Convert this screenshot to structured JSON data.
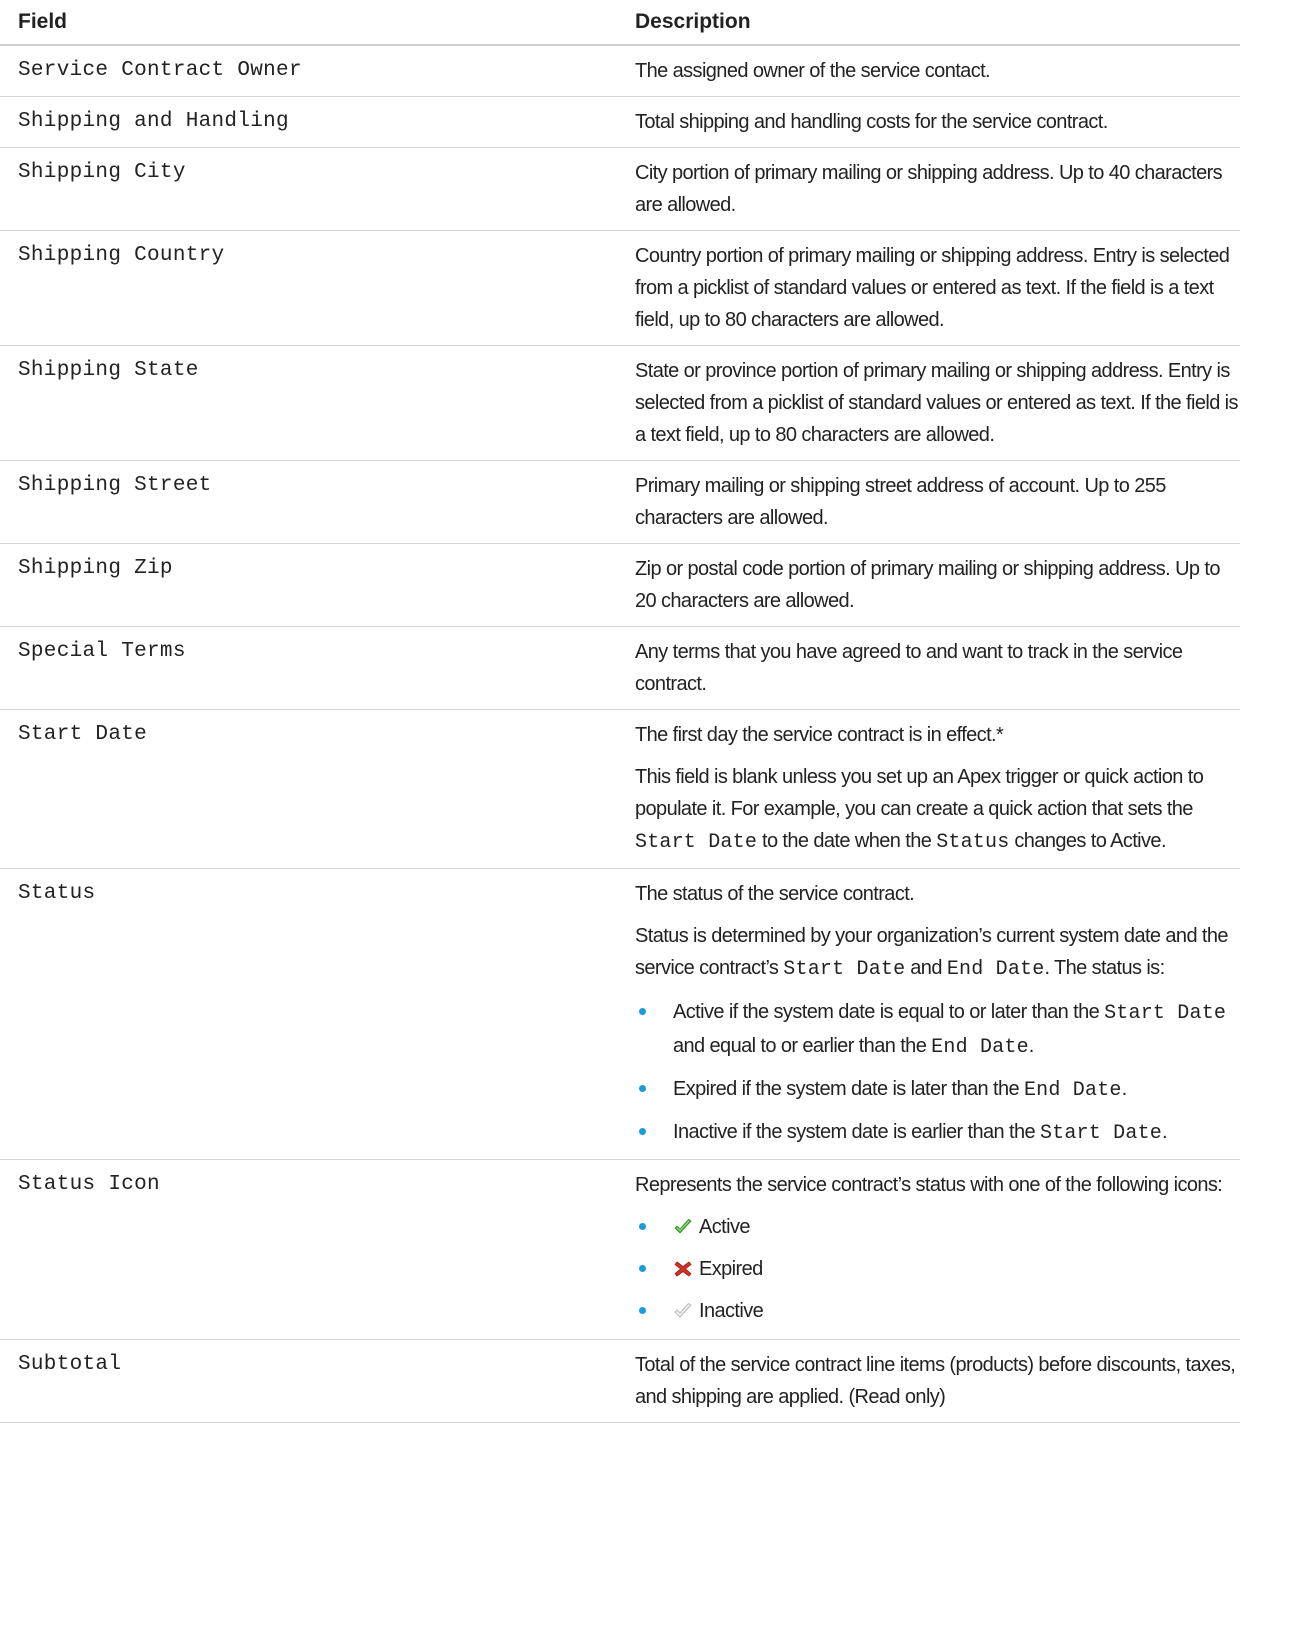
{
  "table": {
    "header": {
      "field": "Field",
      "description": "Description"
    },
    "rows": {
      "service_contract_owner": {
        "field": "Service Contract Owner",
        "description": "The assigned owner of the service contact."
      },
      "shipping_and_handling": {
        "field": "Shipping and Handling",
        "description": "Total shipping and handling costs for the service contract."
      },
      "shipping_city": {
        "field": "Shipping City",
        "description": "City portion of primary mailing or shipping address. Up to 40 characters are allowed."
      },
      "shipping_country": {
        "field": "Shipping Country",
        "description": "Country portion of primary mailing or shipping address. Entry is selected from a picklist of standard values or entered as text. If the field is a text field, up to 80 characters are allowed."
      },
      "shipping_state": {
        "field": "Shipping State",
        "description": "State or province portion of primary mailing or shipping address. Entry is selected from a picklist of standard values or entered as text. If the field is a text field, up to 80 characters are allowed."
      },
      "shipping_street": {
        "field": "Shipping Street",
        "description": "Primary mailing or shipping street address of account. Up to 255 characters are allowed."
      },
      "shipping_zip": {
        "field": "Shipping Zip",
        "description": "Zip or postal code portion of primary mailing or shipping address. Up to 20 characters are allowed."
      },
      "special_terms": {
        "field": "Special Terms",
        "description": "Any terms that you have agreed to and want to track in the service contract."
      },
      "start_date": {
        "field": "Start Date",
        "description": "The first day the service contract is in effect.*",
        "note": {
          "t1": "This field is blank unless you set up an Apex trigger or quick action to populate it. For example, you can create a quick action that sets the ",
          "c1": "Start Date",
          "t2": " to the date when the ",
          "c2": "Status",
          "t3": " changes to Active."
        }
      },
      "status": {
        "field": "Status",
        "description": "The status of the service contract.",
        "explain": {
          "t1": "Status is determined by your organization’s current system date and the service contract’s ",
          "c1": "Start Date",
          "t2": " and ",
          "c2": "End Date",
          "t3": ". The status is:"
        },
        "bullets": {
          "active": {
            "t1": "Active if the system date is equal to or later than the ",
            "c1": "Start Date",
            "t2": " and equal to or earlier than the ",
            "c2": "End Date",
            "t3": "."
          },
          "expired": {
            "t1": "Expired if the system date is later than the ",
            "c1": "End Date",
            "t2": "."
          },
          "inactive": {
            "t1": "Inactive if the system date is earlier than the ",
            "c1": "Start Date",
            "t2": "."
          }
        }
      },
      "status_icon": {
        "field": "Status Icon",
        "description": "Represents the service contract’s status with one of the following icons:",
        "icons": {
          "active": {
            "label": "Active",
            "icon": "green-check-icon",
            "color": "#4bae3c"
          },
          "expired": {
            "label": "Expired",
            "icon": "red-x-icon",
            "color": "#d0332a"
          },
          "inactive": {
            "label": "Inactive",
            "icon": "gray-check-icon",
            "color": "#b8b8b8"
          }
        }
      },
      "subtotal": {
        "field": "Subtotal",
        "description": "Total of the service contract line items (products) before discounts, taxes, and shipping are applied. (Read only)"
      }
    }
  },
  "colors": {
    "bullet": "#1b9bd7",
    "row_border": "#d4d4d4",
    "text": "#222222"
  }
}
